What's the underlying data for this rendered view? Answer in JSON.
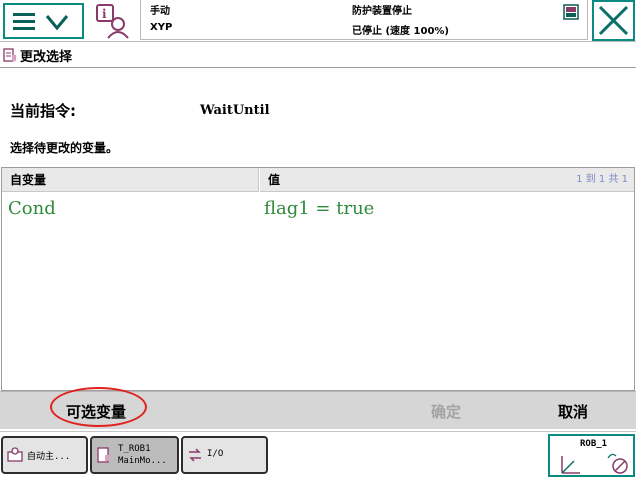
{
  "header": {
    "mode": "手动",
    "system": "XYP",
    "safety": "防护装置停止",
    "run_state": "已停止 (速度 100%)"
  },
  "page": {
    "title": "更改选择"
  },
  "instruction": {
    "label": "当前指令:",
    "value": "WaitUntil",
    "hint": "选择待更改的变量。"
  },
  "table": {
    "headers": {
      "variable": "自变量",
      "value": "值"
    },
    "count": "1 到 1 共 1",
    "rows": [
      {
        "variable": "Cond",
        "value": "flag1 = true"
      }
    ]
  },
  "commands": {
    "optional": "可选变量",
    "ok": "确定",
    "cancel": "取消"
  },
  "taskbar": {
    "auto": "自动主...",
    "rob_line1": "T_ROB1",
    "rob_line2": "MainMo...",
    "io": "I/O"
  },
  "quickset": {
    "label": "ROB_1"
  },
  "colors": {
    "accent": "#0a8a80",
    "value_text": "#2f8a3a",
    "highlight": "#e0211d",
    "disabled": "#a3a3a3"
  },
  "icons": [
    "menu-icon",
    "chevron-down-icon",
    "operator-info-icon",
    "status-flag-icon",
    "close-icon",
    "program-icon",
    "io-icon",
    "robot-axes-icon"
  ]
}
